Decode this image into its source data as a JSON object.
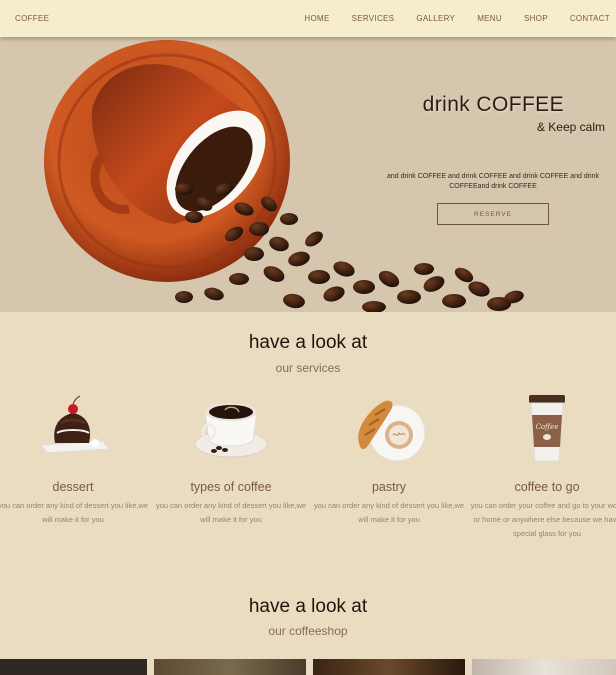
{
  "nav": {
    "brand": "COFFEE",
    "items": [
      {
        "label": "HOME"
      },
      {
        "label": "SERVICES"
      },
      {
        "label": "GALLERY"
      },
      {
        "label": "MENU"
      },
      {
        "label": "SHOP"
      },
      {
        "label": "CONTACT"
      }
    ]
  },
  "hero": {
    "title": "drink COFFEE",
    "subtitle": "& Keep calm",
    "text": "and drink COFFEE and drink COFFEE and drink COFFEE and drink COFFEEand drink COFFEE",
    "button": "RESERVE"
  },
  "services": {
    "title": "have a look at",
    "subtitle": "our services",
    "items": [
      {
        "name": "dessert",
        "desc": "you can order any kind of dessert you like,we will make it for you",
        "icon": "dessert-icon"
      },
      {
        "name": "types of coffee",
        "desc": "you can order any kind of dessert you like,we will make it for you",
        "icon": "coffee-cup-icon"
      },
      {
        "name": "pastry",
        "desc": "you can order any kind of dessert you like,we will make it for you",
        "icon": "croissant-icon"
      },
      {
        "name": "coffee to go",
        "desc": "you can order your coffee and go to your work or home or anywhere else because we have special glass for you",
        "icon": "coffee-to-go-icon",
        "cup_label": "Coffee"
      }
    ]
  },
  "coffeeshop": {
    "title": "have a look at",
    "subtitle": "our coffeeshop"
  },
  "colors": {
    "nav_bg": "#f6ecce",
    "hero_bg": "#d5c6ad",
    "page_bg": "#e9dcc1",
    "accent_brown": "#7b5a42"
  }
}
